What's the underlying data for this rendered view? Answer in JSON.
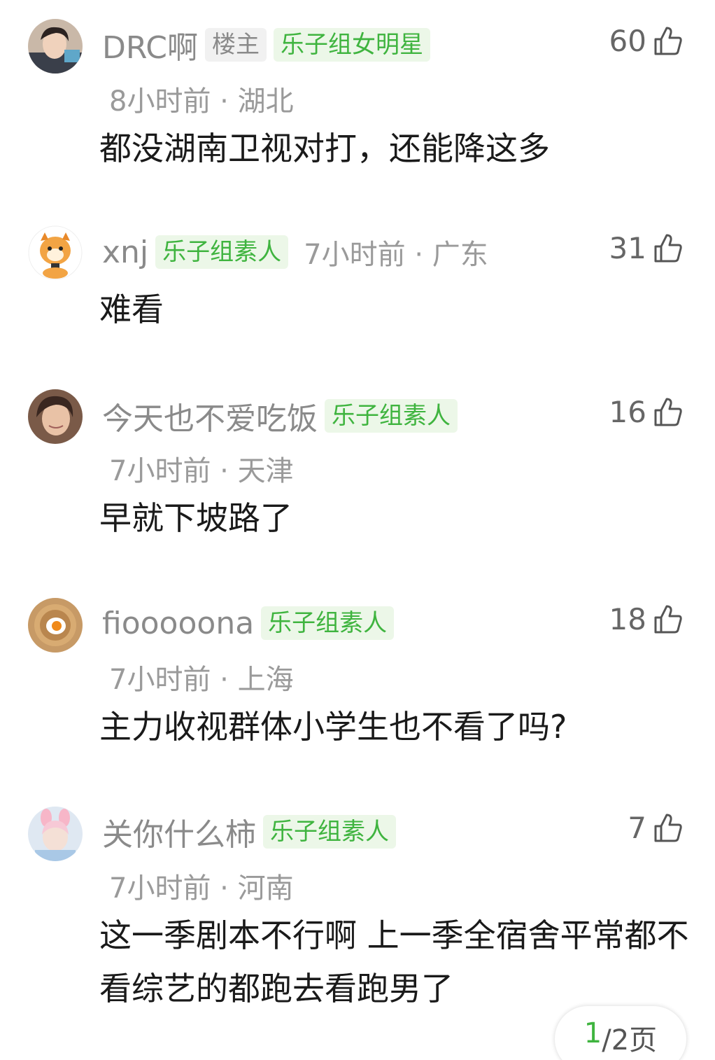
{
  "comments": [
    {
      "username": "DRC啊",
      "op_tag": "楼主",
      "group_tag": "乐子组女明星",
      "time": "8小时前",
      "location": "湖北",
      "likes": "60",
      "text": "都没湖南卫视对打，还能降这多"
    },
    {
      "username": "xnj",
      "group_tag": "乐子组素人",
      "time": "7小时前",
      "location": "广东",
      "likes": "31",
      "text": "难看"
    },
    {
      "username": "今天也不爱吃饭",
      "group_tag": "乐子组素人",
      "time": "7小时前",
      "location": "天津",
      "likes": "16",
      "text": "早就下坡路了"
    },
    {
      "username": "fiooooona",
      "group_tag": "乐子组素人",
      "time": "7小时前",
      "location": "上海",
      "likes": "18",
      "text": "主力收视群体小学生也不看了吗?"
    },
    {
      "username": "关你什么柿",
      "group_tag": "乐子组素人",
      "time": "7小时前",
      "location": "河南",
      "likes": "7",
      "text": "这一季剧本不行啊 上一季全宿舍平常都不看综艺的都跑去看跑男了"
    }
  ],
  "separator": "·",
  "pager": {
    "current": "1",
    "total_label": "/2页"
  },
  "icons": {
    "like": "thumbs-up-icon"
  },
  "colors": {
    "tag_green": "#3fb43f",
    "tag_green_bg": "#ecf7e8",
    "meta_gray": "#9a9a9a"
  }
}
